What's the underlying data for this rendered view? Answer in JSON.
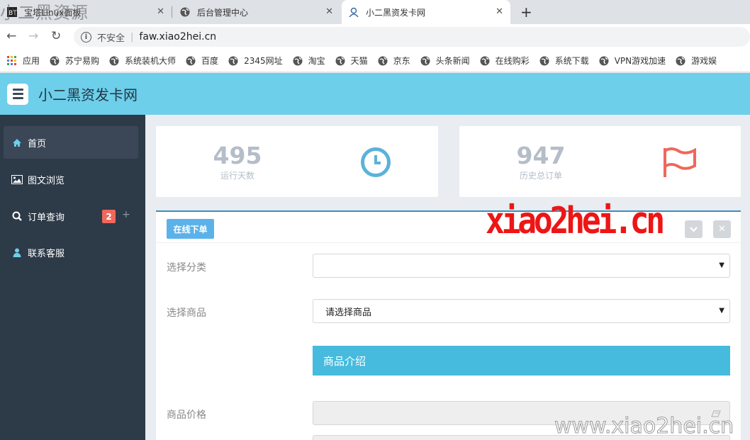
{
  "browser": {
    "tabs": [
      {
        "label": "宝塔Linux面板"
      },
      {
        "label": "后台管理中心"
      },
      {
        "label": "小二黑资发卡网"
      }
    ],
    "address": {
      "insecure": "不安全",
      "url": "faw.xiao2hei.cn"
    },
    "bookmarks": [
      "应用",
      "苏宁易购",
      "系统装机大师",
      "百度",
      "2345网址",
      "淘宝",
      "天猫",
      "京东",
      "头条新闻",
      "在线购彩",
      "系统下载",
      "VPN游戏加速",
      "游戏娱"
    ]
  },
  "header": {
    "title": "小二黑资发卡网"
  },
  "sidebar": {
    "items": [
      {
        "label": "首页"
      },
      {
        "label": "图文浏览"
      },
      {
        "label": "订单查询",
        "badge": "2",
        "plus": "+"
      },
      {
        "label": "联系客服"
      }
    ]
  },
  "stats": [
    {
      "value": "495",
      "label": "运行天数"
    },
    {
      "value": "947",
      "label": "历史总订单"
    }
  ],
  "panel": {
    "button": "在线下单",
    "fields": {
      "category_label": "选择分类",
      "category_value": "",
      "product_label": "选择商品",
      "product_value": "请选择商品",
      "intro": "商品介绍",
      "price_label": "商品价格"
    }
  },
  "watermarks": {
    "top": "小二黑资源",
    "red": "xiao2hei.cn",
    "bottom": "www.xiao2hei.cn"
  },
  "colors": {
    "header": "#6dcfe9",
    "sidebar": "#2d3a48",
    "accent": "#46bbde",
    "badge": "#f0675b"
  }
}
